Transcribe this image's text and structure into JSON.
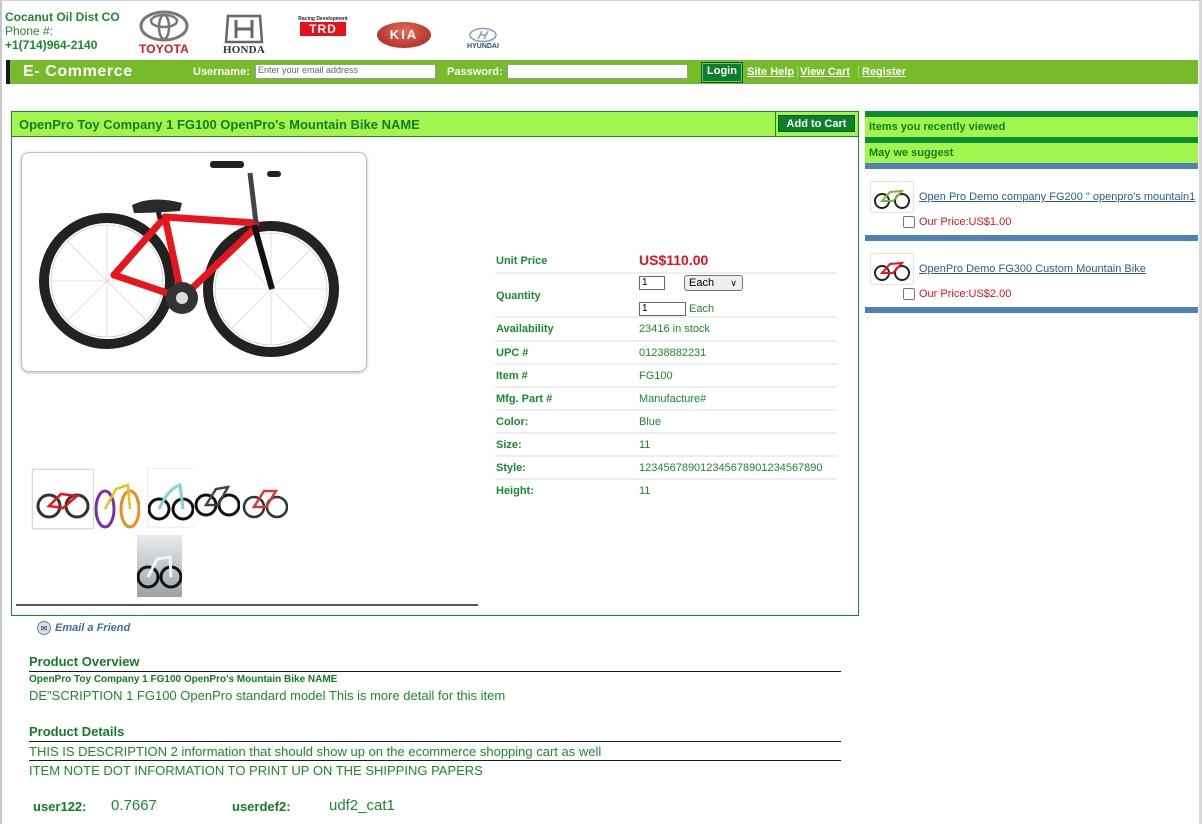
{
  "company": {
    "name": "Cocanut Oil Dist CO",
    "phone_label": "Phone #:",
    "phone": "+1(714)964-2140"
  },
  "brand_logos": [
    {
      "name": "TOYOTA",
      "icon": "toyota-logo",
      "color": "#d71921"
    },
    {
      "name": "HONDA",
      "icon": "honda-logo",
      "color": "#333333"
    },
    {
      "name": "TRD",
      "icon": "trd-logo",
      "color": "#e4101b",
      "caption": "Racing Development"
    },
    {
      "name": "KIA",
      "icon": "kia-logo",
      "color": "#c0392b"
    },
    {
      "name": "HYUNDAI",
      "icon": "hyundai-logo",
      "color": "#2b4f86"
    }
  ],
  "navbar": {
    "brand": "E- Commerce",
    "username_label": "Username:",
    "username_placeholder": "Enter your email address",
    "username_value": "",
    "password_label": "Password:",
    "password_value": "",
    "login_label": "Login",
    "links": [
      "Site Help",
      "View Cart",
      "Register"
    ]
  },
  "product": {
    "title": "OpenPro Toy Company 1 FG100 OpenPro's Mountain Bike NAME",
    "add_to_cart": "Add to Cart",
    "main_image": "red-bmx-bike-image",
    "thumbnails": [
      "red-bmx-bike",
      "yellow-cruiser-bike",
      "white-concept-bike",
      "black-mountain-bike",
      "red-road-bike",
      "silver-e-bike"
    ],
    "unit_price_label": "Unit Price",
    "unit_price": "US$110.00",
    "quantity_label": "Quantity",
    "quantity_value": "1",
    "uom_selected": "Each",
    "quantity_value_2": "1",
    "uom_2": "Each",
    "specs": [
      {
        "label": "Availability",
        "value": "23416 in stock"
      },
      {
        "label": "UPC #",
        "value": "01238882231"
      },
      {
        "label": "Item #",
        "value": "FG100"
      },
      {
        "label": "Mfg. Part #",
        "value": "Manufacture#"
      },
      {
        "label": "Color:",
        "value": "Blue"
      },
      {
        "label": "Size:",
        "value": "11"
      },
      {
        "label": "Style:",
        "value": "123456789012345678901234567890"
      },
      {
        "label": "Height:",
        "value": "11"
      }
    ]
  },
  "sidebar": {
    "recently_viewed": "Items you recently viewed",
    "suggest": "May we suggest",
    "suggestions": [
      {
        "name": "Open Pro Demo company FG200 \" openpro's mountain1",
        "price": "Our Price:US$1.00",
        "image": "green-bike-thumb"
      },
      {
        "name": "OpenPro Demo FG300 Custom Mountain Bike",
        "price": "Our Price:US$2.00",
        "image": "red-bike-thumb"
      }
    ]
  },
  "email_friend": "Email a Friend",
  "overview": {
    "title": "Product Overview",
    "subtitle": "OpenPro Toy Company 1 FG100 OpenPro's Mountain Bike NAME",
    "description": "DE\"SCRIPTION 1 FG100 OpenPro standard model This is more detail for this item"
  },
  "details": {
    "title": "Product Details",
    "line1": "THIS IS DESCRIPTION 2 information that should show up on the ecommerce shopping cart as well",
    "line2": "ITEM NOTE DOT INFORMATION TO PRINT UP ON THE SHIPPING PAPERS"
  },
  "user_fields": [
    {
      "label": "user122:",
      "value": "0.7667"
    },
    {
      "label": "userdef2:",
      "value": "udf2_cat1"
    }
  ],
  "colors": {
    "green_text": "#1b8a2e",
    "nav_green": "#76bb2a",
    "header_lime": "#a2f54d",
    "button_green": "#0d7f2b",
    "price_red": "#e4101b",
    "side_blue": "#4f81b2"
  }
}
